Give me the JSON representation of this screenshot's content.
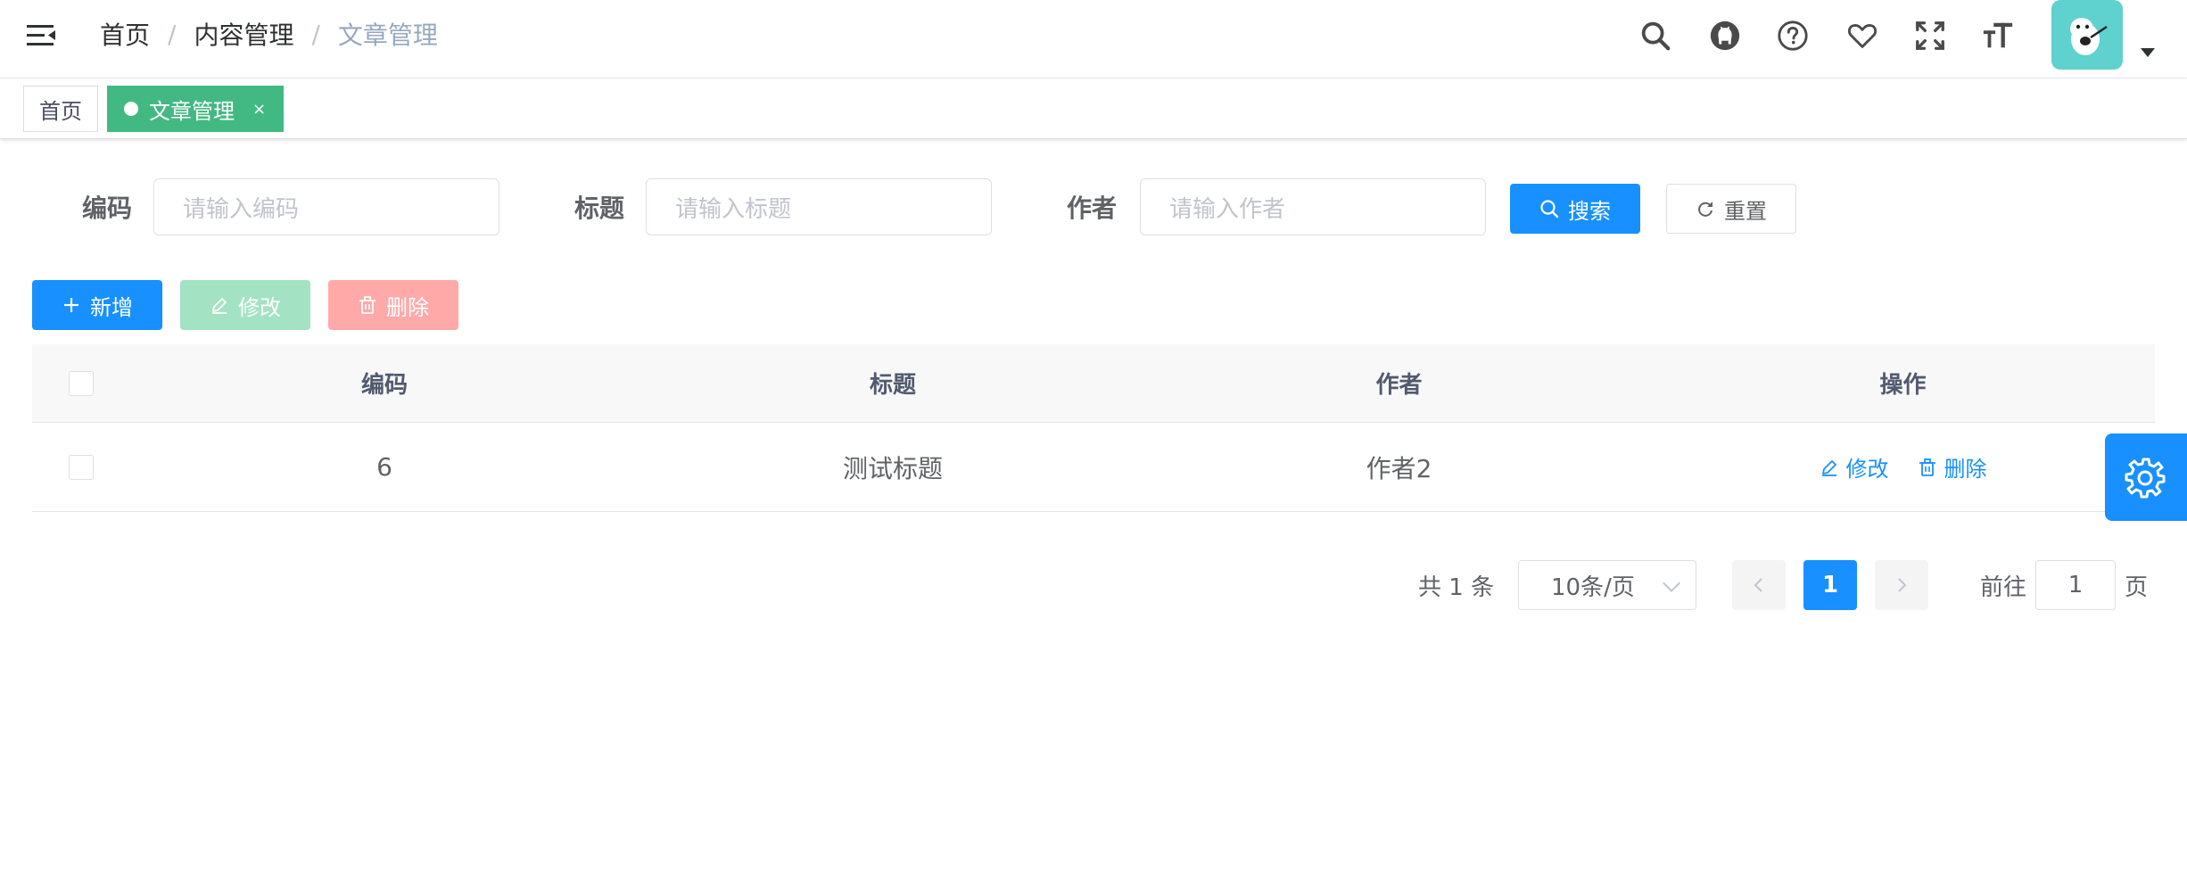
{
  "navbar": {
    "breadcrumb": [
      "首页",
      "内容管理",
      "文章管理"
    ],
    "breadcrumb_separator": "/",
    "icons": [
      "search-icon",
      "github-icon",
      "help-circle-icon",
      "heart-icon",
      "fullscreen-icon",
      "font-size-icon"
    ],
    "avatar_color": "#5fd1cf"
  },
  "tags_view": {
    "home_tag": "首页",
    "active_tag": "文章管理",
    "active_tag_close": "×",
    "active_color": "#42b983"
  },
  "search_form": {
    "fields": [
      {
        "label": "编码",
        "placeholder": "请输入编码",
        "value": ""
      },
      {
        "label": "标题",
        "placeholder": "请输入标题",
        "value": ""
      },
      {
        "label": "作者",
        "placeholder": "请输入作者",
        "value": ""
      }
    ],
    "search_label": "搜索",
    "reset_label": "重置"
  },
  "toolbar": {
    "add_label": "新增",
    "edit_label": "修改",
    "delete_label": "删除"
  },
  "table": {
    "columns": [
      "编码",
      "标题",
      "作者",
      "操作"
    ],
    "rows": [
      {
        "code": "6",
        "title": "测试标题",
        "author": "作者2",
        "edit_label": "修改",
        "delete_label": "删除"
      }
    ]
  },
  "pagination": {
    "total_text": "共 1 条",
    "page_size": "10条/页",
    "current_page": "1",
    "goto_label": "前往",
    "goto_value": "1",
    "page_unit": "页"
  },
  "colors": {
    "primary": "#1890ff",
    "success_plain": "#a3e3c4",
    "danger_plain": "#ffa9a9"
  }
}
